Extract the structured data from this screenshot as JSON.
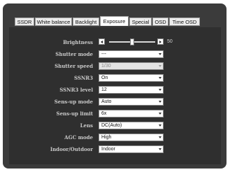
{
  "tabs": [
    {
      "label": "SSDR",
      "active": false
    },
    {
      "label": "White balance",
      "active": false
    },
    {
      "label": "Backlight",
      "active": false
    },
    {
      "label": "Exposure",
      "active": true
    },
    {
      "label": "Special",
      "active": false
    },
    {
      "label": "OSD",
      "active": false
    },
    {
      "label": "Time OSD",
      "active": false
    }
  ],
  "settings": {
    "brightness": {
      "label": "Brightness",
      "value": "50"
    },
    "shutter_mode": {
      "label": "Shutter mode",
      "value": "---",
      "enabled": true
    },
    "shutter_speed": {
      "label": "Shutter speed",
      "value": "1/30",
      "enabled": false
    },
    "ssnr3": {
      "label": "SSNR3",
      "value": "On",
      "enabled": true
    },
    "ssnr3_level": {
      "label": "SSNR3 level",
      "value": "12",
      "enabled": true
    },
    "sens_up_mode": {
      "label": "Sens-up mode",
      "value": "Auto",
      "enabled": true
    },
    "sens_up_limit": {
      "label": "Sens-up limit",
      "value": "6x",
      "enabled": true
    },
    "lens": {
      "label": "Lens",
      "value": "DC(Auto)",
      "enabled": true
    },
    "agc_mode": {
      "label": "AGC mode",
      "value": "High",
      "enabled": true
    },
    "indoor_outdoor": {
      "label": "Indoor/Outdoor",
      "value": "Indoor",
      "enabled": true
    }
  },
  "brightness_slider": {
    "min": 0,
    "max": 100,
    "value": 50
  }
}
